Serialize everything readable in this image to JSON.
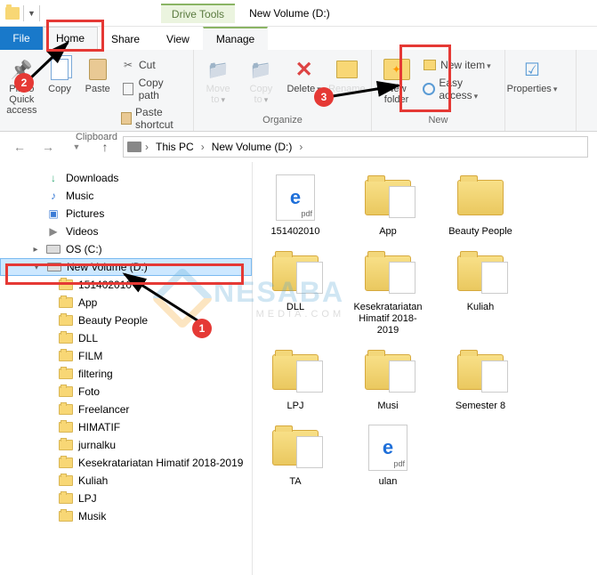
{
  "titlebar": {
    "drive_tools": "Drive Tools",
    "title": "New Volume (D:)"
  },
  "tabs": {
    "file": "File",
    "home": "Home",
    "share": "Share",
    "view": "View",
    "manage": "Manage"
  },
  "ribbon": {
    "clipboard": {
      "pin": "Pin to Quick access",
      "copy": "Copy",
      "paste": "Paste",
      "cut": "Cut",
      "copy_path": "Copy path",
      "paste_shortcut": "Paste shortcut",
      "group": "Clipboard"
    },
    "organize": {
      "move_to": "Move to",
      "copy_to": "Copy to",
      "delete": "Delete",
      "rename": "Rename",
      "group": "Organize"
    },
    "new": {
      "new_folder": "New folder",
      "new_item": "New item",
      "easy_access": "Easy access",
      "group": "New"
    },
    "open": {
      "properties": "Properties"
    }
  },
  "breadcrumb": {
    "this_pc": "This PC",
    "volume": "New Volume (D:)"
  },
  "sidebar": {
    "items": [
      {
        "label": "Downloads",
        "icon": "dl",
        "indent": 1
      },
      {
        "label": "Music",
        "icon": "music",
        "indent": 1
      },
      {
        "label": "Pictures",
        "icon": "pic",
        "indent": 1
      },
      {
        "label": "Videos",
        "icon": "vid",
        "indent": 1
      },
      {
        "label": "OS (C:)",
        "icon": "drive",
        "indent": 1
      },
      {
        "label": "New Volume (D:)",
        "icon": "drive",
        "indent": 1,
        "selected": true,
        "expanded": true
      },
      {
        "label": "151402010",
        "icon": "folder",
        "indent": 2
      },
      {
        "label": "App",
        "icon": "folder",
        "indent": 2
      },
      {
        "label": "Beauty People",
        "icon": "folder",
        "indent": 2
      },
      {
        "label": "DLL",
        "icon": "folder",
        "indent": 2
      },
      {
        "label": "FILM",
        "icon": "folder",
        "indent": 2
      },
      {
        "label": "filtering",
        "icon": "folder",
        "indent": 2
      },
      {
        "label": "Foto",
        "icon": "folder",
        "indent": 2
      },
      {
        "label": "Freelancer",
        "icon": "folder",
        "indent": 2
      },
      {
        "label": "HIMATIF",
        "icon": "folder",
        "indent": 2
      },
      {
        "label": "jurnalku",
        "icon": "folder",
        "indent": 2
      },
      {
        "label": "Kesekratariatan Himatif 2018-2019",
        "icon": "folder",
        "indent": 2
      },
      {
        "label": "Kuliah",
        "icon": "folder",
        "indent": 2
      },
      {
        "label": "LPJ",
        "icon": "folder",
        "indent": 2
      },
      {
        "label": "Musik",
        "icon": "folder",
        "indent": 2
      }
    ]
  },
  "content": {
    "items": [
      {
        "name": "151402010",
        "type": "pdf"
      },
      {
        "name": "App",
        "type": "folder-preview"
      },
      {
        "name": "Beauty People",
        "type": "folder"
      },
      {
        "name": "DLL",
        "type": "folder-preview"
      },
      {
        "name": "Kesekratariatan Himatif 2018-2019",
        "type": "folder-preview"
      },
      {
        "name": "Kuliah",
        "type": "folder-preview"
      },
      {
        "name": "LPJ",
        "type": "folder-preview"
      },
      {
        "name": "Musi",
        "type": "folder-preview"
      },
      {
        "name": "Semester 8",
        "type": "folder-preview"
      },
      {
        "name": "TA",
        "type": "folder-preview"
      },
      {
        "name": "ulan",
        "type": "pdf"
      }
    ]
  },
  "annotations": {
    "step1": "1",
    "step2": "2",
    "step3": "3"
  },
  "watermark": {
    "text": "NESABA",
    "sub": "MEDIA.COM"
  }
}
